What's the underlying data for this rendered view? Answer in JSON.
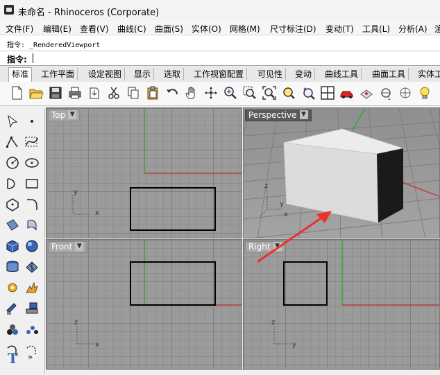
{
  "window": {
    "title": "未命名 - Rhinoceros (Corporate)"
  },
  "menu": [
    "文件(F)",
    "编辑(E)",
    "查看(V)",
    "曲线(C)",
    "曲面(S)",
    "实体(O)",
    "网格(M)",
    "尺寸标注(D)",
    "变动(T)",
    "工具(L)",
    "分析(A)",
    "渲"
  ],
  "command": {
    "history": "指令: _RenderedViewport",
    "prompt_label": "指令:",
    "input_value": ""
  },
  "tabs": [
    "标准",
    "工作平面",
    "设定视图",
    "显示",
    "选取",
    "工作视窗配置",
    "可见性",
    "变动",
    "曲线工具",
    "曲面工具",
    "实体工"
  ],
  "active_tab": "标准",
  "toolbar_icons": [
    "new-file-icon",
    "open-folder-icon",
    "save-icon",
    "print-icon",
    "import-icon",
    "cut-icon",
    "copy-icon",
    "paste-icon",
    "undo-icon",
    "pan-hand-icon",
    "rotate-view-icon",
    "zoom-dynamic-icon",
    "zoom-window-icon",
    "zoom-extents-icon",
    "zoom-selected-icon",
    "undo-view-icon",
    "four-viewports-icon",
    "render-car-icon",
    "material-icon",
    "lock-icon",
    "light-bulb-icon"
  ],
  "left_tools": [
    "select-arrow-icon",
    "point-icon",
    "polyline-icon",
    "curve-icon",
    "circle-icon",
    "ellipse-icon",
    "arc-icon",
    "rectangle-icon",
    "polygon-icon",
    "fillet-curve-icon",
    "surface-corners-icon",
    "surface-extrude-icon",
    "box-solid-icon",
    "sphere-icon",
    "mesh-icon",
    "patch-icon",
    "transform-gear-icon",
    "explode-icon",
    "boolean-split-icon",
    "boolean-union-icon",
    "group-icon",
    "array-icon",
    "curve-fillet-icon",
    "dimension-icon",
    "text-icon",
    "more-tools-icon"
  ],
  "viewports": {
    "top": {
      "label": "Top",
      "axis_x": "x",
      "axis_y": "y"
    },
    "perspective": {
      "label": "Perspective",
      "axis_x": "x",
      "axis_y": "y",
      "axis_z": "z"
    },
    "front": {
      "label": "Front",
      "axis_x": "x",
      "axis_y": "z"
    },
    "right": {
      "label": "Right",
      "axis_x": "y",
      "axis_y": "z"
    }
  },
  "colors": {
    "x_axis": "#c23b3b",
    "y_axis": "#2fa82f",
    "annotation_arrow": "#e8322a",
    "box_face_light": "#dedede",
    "box_face_dark": "#1a1a1a"
  }
}
